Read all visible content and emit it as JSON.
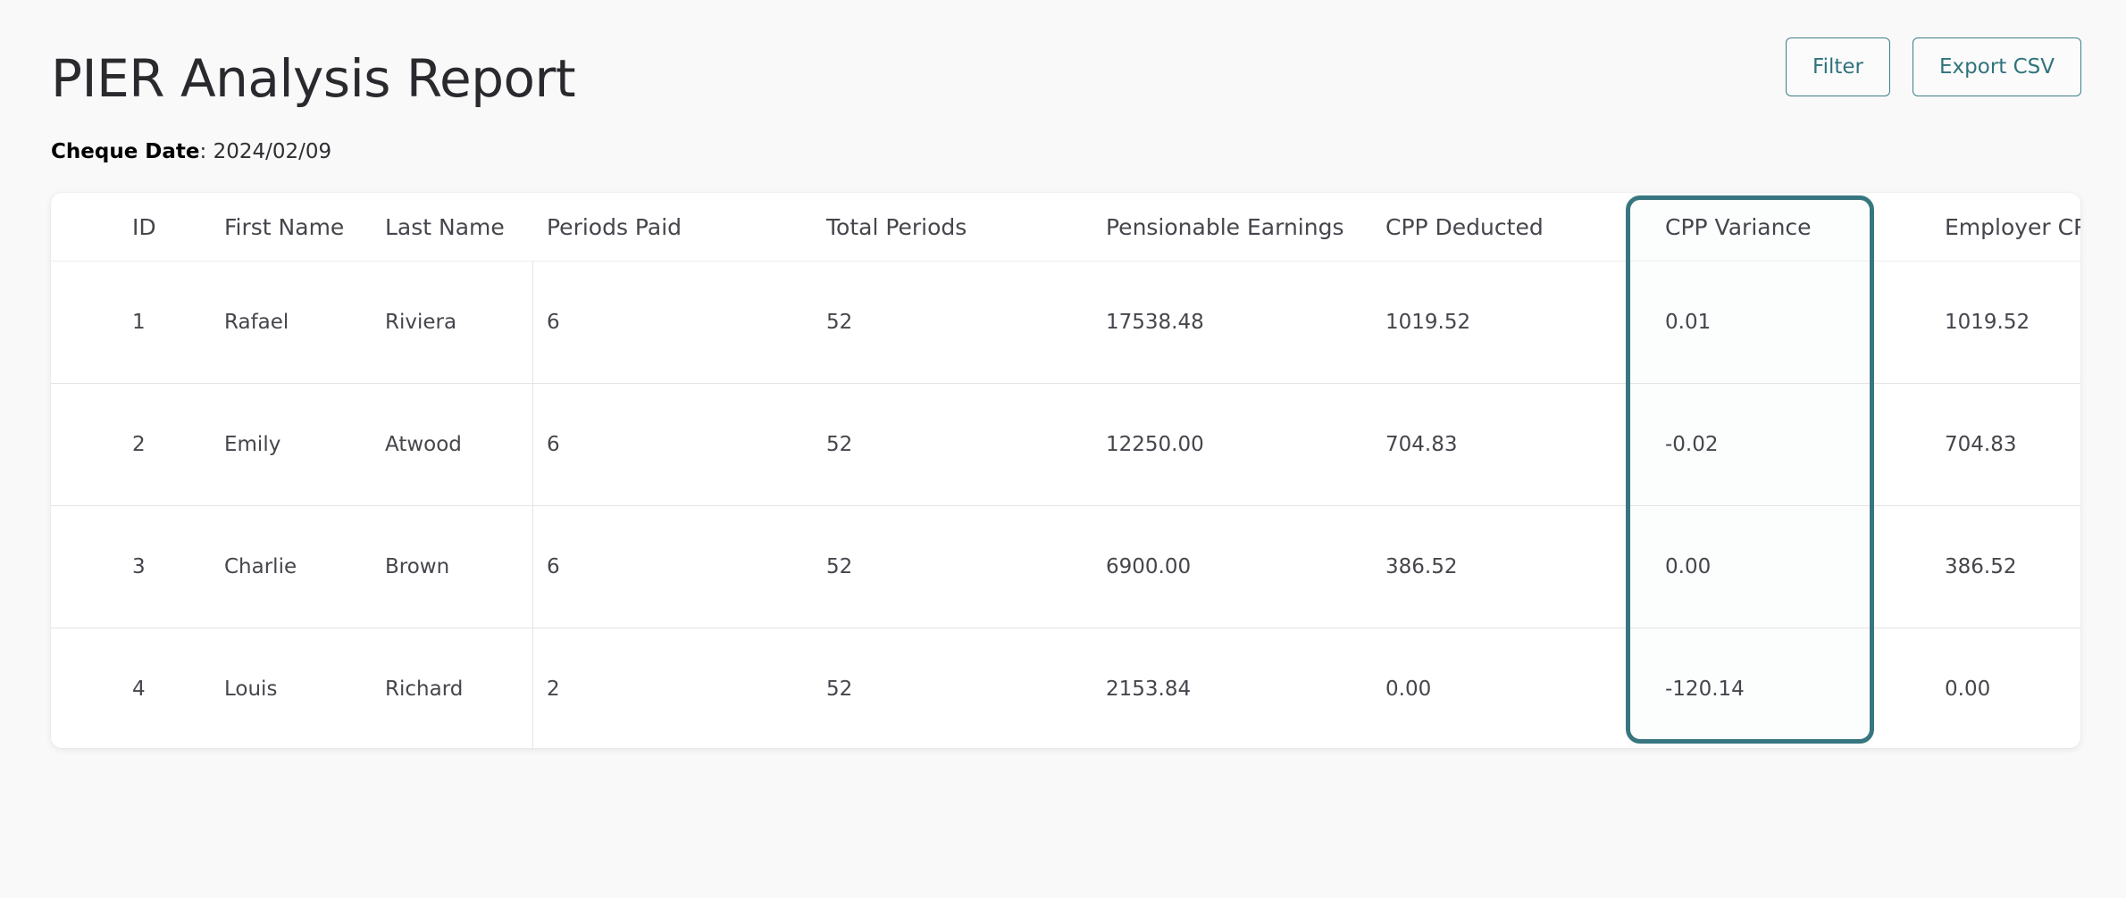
{
  "page": {
    "title": "PIER Analysis Report",
    "cheque_date_label": "Cheque Date",
    "cheque_date_value": "2024/02/09"
  },
  "toolbar": {
    "filter_label": "Filter",
    "export_label": "Export CSV"
  },
  "table": {
    "columns": [
      "ID",
      "First Name",
      "Last Name",
      "Periods Paid",
      "Total Periods",
      "Pensionable Earnings",
      "CPP Deducted",
      "CPP Variance",
      "Employer CP"
    ],
    "rows": [
      [
        "1",
        "Rafael",
        "Riviera",
        "6",
        "52",
        "17538.48",
        "1019.52",
        "0.01",
        "1019.52"
      ],
      [
        "2",
        "Emily",
        "Atwood",
        "6",
        "52",
        "12250.00",
        "704.83",
        "-0.02",
        "704.83"
      ],
      [
        "3",
        "Charlie",
        "Brown",
        "6",
        "52",
        "6900.00",
        "386.52",
        "0.00",
        "386.52"
      ],
      [
        "4",
        "Louis",
        "Richard",
        "2",
        "52",
        "2153.84",
        "0.00",
        "-120.14",
        "0.00"
      ]
    ],
    "highlighted_column": "CPP Variance"
  },
  "colors": {
    "accent": "#38767f",
    "button_text": "#2f737c",
    "background": "#f9f9f9"
  }
}
